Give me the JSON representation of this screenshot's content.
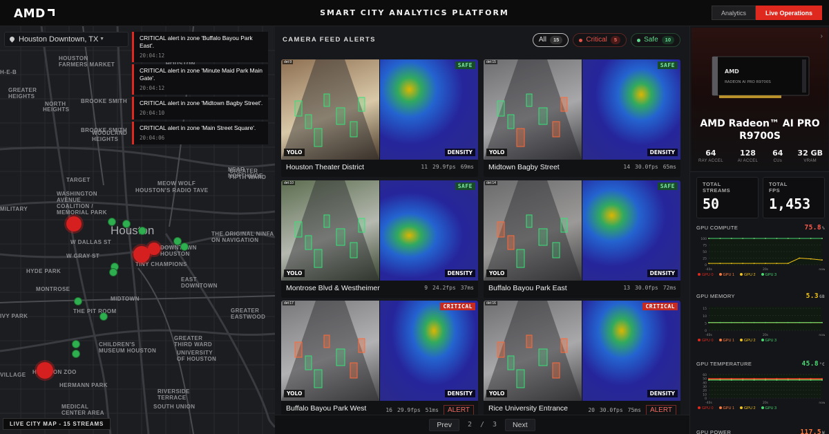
{
  "header": {
    "logo_text": "AMD",
    "title": "SMART CITY ANALYTICS PLATFORM",
    "tabs": [
      {
        "label": "Analytics",
        "active": false
      },
      {
        "label": "Live Operations",
        "active": true
      }
    ],
    "accent_color": "#e0291e"
  },
  "map": {
    "location": "Houston Downtown, TX",
    "footer_label": "LIVE CITY MAP - 15 STREAMS",
    "labels": [
      "MEYERLAND",
      "ZONE",
      "Houston\nFarmers Market",
      "H-E-B",
      "GREATER\nHEIGHTS",
      "NORTH",
      "HEIGHTS",
      "BROOKE SMITH",
      "BROOKE SMITH",
      "WOODLAND\nHEIGHTS",
      "Houston",
      "Target",
      "Meow Wolf",
      "Houston's Radio Tave",
      "NEAR\nNORTHSIDE",
      "GREATER\nFIFTH WARD",
      "WASHINGTON\nAVENUE\nCOALITION /\nMEMORIAL PARK",
      "MILITARY",
      "The Original Ninfa\non Navigation",
      "Houston",
      "DOWNTOWN\nHOUSTON",
      "Tiny Champions",
      "W Dallas St",
      "W Gray St",
      "HYDE PARK",
      "MONTROSE",
      "MIDTOWN",
      "EAST\nDOWNTOWN",
      "The Pit Room",
      "GREATER\nEASTWOOD",
      "Children's\nMuseum Houston",
      "GREATER\nTHIRD WARD",
      "University\nof Houston",
      "Houston Zoo",
      "Hermann Park",
      "MEDICAL\nCENTER AREA",
      "RIVERSIDE\nTERRACE",
      "SOUTH UNION",
      "VILLAGE",
      "Ivy Park"
    ],
    "markers": [
      {
        "status": "critical"
      },
      {
        "status": "critical"
      },
      {
        "status": "critical"
      },
      {
        "status": "critical"
      },
      {
        "status": "safe"
      },
      {
        "status": "safe"
      },
      {
        "status": "safe"
      },
      {
        "status": "safe"
      },
      {
        "status": "safe"
      },
      {
        "status": "safe"
      },
      {
        "status": "safe"
      },
      {
        "status": "safe"
      },
      {
        "status": "safe"
      },
      {
        "status": "safe"
      },
      {
        "status": "safe"
      }
    ]
  },
  "alerts": [
    {
      "text": "CRITICAL alert in zone 'Buffalo Bayou Park East'.",
      "time": "20:04:12"
    },
    {
      "text": "CRITICAL alert in zone 'Minute Maid Park Main Gate'.",
      "time": "20:04:12"
    },
    {
      "text": "CRITICAL alert in zone 'Midtown Bagby Street'.",
      "time": "20:04:10"
    },
    {
      "text": "CRITICAL alert in zone 'Main Street Square'.",
      "time": "20:04:06"
    }
  ],
  "feeds": {
    "title": "CAMERA FEED ALERTS",
    "filters": [
      {
        "label": "All",
        "count": "15"
      },
      {
        "label": "Critical",
        "count": "5"
      },
      {
        "label": "Safe",
        "count": "10"
      }
    ],
    "yolo_label": "YOLO",
    "density_label": "DENSITY",
    "alert_label": "ALERT",
    "cameras": [
      {
        "id": "det:9",
        "name": "Houston Theater District",
        "count": "11",
        "fps": "29.9fps",
        "latency": "69ms",
        "status": "SAFE"
      },
      {
        "id": "det:15",
        "name": "Midtown Bagby Street",
        "count": "14",
        "fps": "30.0fps",
        "latency": "65ms",
        "status": "SAFE"
      },
      {
        "id": "det:10",
        "name": "Montrose Blvd & Westheimer",
        "count": "9",
        "fps": "24.2fps",
        "latency": "37ms",
        "status": "SAFE"
      },
      {
        "id": "det:14",
        "name": "Buffalo Bayou Park East",
        "count": "13",
        "fps": "30.0fps",
        "latency": "72ms",
        "status": "SAFE"
      },
      {
        "id": "det:17",
        "name": "Buffalo Bayou Park West",
        "count": "16",
        "fps": "29.9fps",
        "latency": "51ms",
        "status": "CRITICAL"
      },
      {
        "id": "det:16",
        "name": "Rice University Entrance",
        "count": "20",
        "fps": "30.0fps",
        "latency": "75ms",
        "status": "CRITICAL"
      }
    ],
    "pager": {
      "prev": "Prev",
      "page": "2",
      "sep": "/",
      "total": "3",
      "next": "Next"
    }
  },
  "side": {
    "gpu_name": "AMD Radeon™ AI PRO\nR9700S",
    "card_label": "RADEON AI PRO R9700S",
    "specs": [
      {
        "value": "64",
        "label": "RAY ACCEL"
      },
      {
        "value": "128",
        "label": "AI ACCEL"
      },
      {
        "value": "64",
        "label": "CUs"
      },
      {
        "value": "32 GB",
        "label": "VRAM"
      }
    ],
    "kpis": [
      {
        "label": "TOTAL\nSTREAMS",
        "value": "50"
      },
      {
        "label": "TOTAL\nFPS",
        "value": "1,453"
      }
    ],
    "metrics": [
      {
        "key": "gpu_compute",
        "label": "GPU COMPUTE",
        "value": "75.8",
        "unit": "%",
        "color": "#ff5a4a",
        "y_ticks": [
          "100",
          "75",
          "50",
          "25",
          "0"
        ],
        "x_ticks": [
          "-40s",
          "20s",
          "now"
        ]
      },
      {
        "key": "gpu_memory",
        "label": "GPU MEMORY",
        "value": "5.3",
        "unit": "GB",
        "color": "#f5c518",
        "y_ticks": [
          "15",
          "10",
          "5",
          "0"
        ],
        "x_ticks": [
          "-40s",
          "20s",
          "now"
        ]
      },
      {
        "key": "gpu_temp",
        "label": "GPU TEMPERATURE",
        "value": "45.8",
        "unit": "°C",
        "color": "#49d872",
        "y_ticks": [
          "60",
          "50",
          "40",
          "30",
          "20",
          "10",
          "0"
        ],
        "x_ticks": [
          "-40s",
          "20s",
          "now"
        ]
      },
      {
        "key": "gpu_power",
        "label": "GPU POWER",
        "value": "117.5",
        "unit": "W",
        "color": "#ff7a3d"
      }
    ],
    "series_legend": [
      "GPU 0",
      "GPU 1",
      "GPU 2",
      "GPU 3"
    ],
    "series_colors": [
      "#e0291e",
      "#ff7a3d",
      "#f5c518",
      "#49d872"
    ]
  },
  "chart_data": [
    {
      "type": "line",
      "title": "GPU COMPUTE",
      "x": [
        -40,
        -36,
        -32,
        -28,
        -24,
        -20,
        -16,
        -12,
        -8,
        -4,
        0
      ],
      "x_ticks": [
        "-40s",
        "20s",
        "now"
      ],
      "ylim": [
        0,
        100
      ],
      "series": [
        {
          "name": "GPU 0",
          "values": [
            100,
            100,
            100,
            100,
            100,
            100,
            100,
            100,
            100,
            100,
            100
          ]
        },
        {
          "name": "GPU 1",
          "values": [
            100,
            100,
            100,
            100,
            100,
            100,
            100,
            100,
            100,
            100,
            100
          ]
        },
        {
          "name": "GPU 2",
          "values": [
            5,
            5,
            5,
            5,
            5,
            5,
            5,
            5,
            25,
            22,
            18
          ]
        },
        {
          "name": "GPU 3",
          "values": [
            100,
            100,
            100,
            100,
            100,
            100,
            100,
            100,
            100,
            100,
            100
          ]
        }
      ]
    },
    {
      "type": "line",
      "title": "GPU MEMORY",
      "x": [
        -40,
        -36,
        -32,
        -28,
        -24,
        -20,
        -16,
        -12,
        -8,
        -4,
        0
      ],
      "x_ticks": [
        "-40s",
        "20s",
        "now"
      ],
      "ylim": [
        0,
        16
      ],
      "series": [
        {
          "name": "GPU 0",
          "values": [
            5.3,
            5.3,
            5.3,
            5.3,
            5.3,
            5.3,
            5.3,
            5.3,
            5.3,
            5.3,
            5.3
          ]
        },
        {
          "name": "GPU 1",
          "values": [
            5.3,
            5.3,
            5.3,
            5.3,
            5.3,
            5.3,
            5.3,
            5.3,
            5.3,
            5.3,
            5.3
          ]
        },
        {
          "name": "GPU 2",
          "values": [
            5.3,
            5.3,
            5.3,
            5.3,
            5.3,
            5.3,
            5.3,
            5.3,
            5.3,
            5.3,
            5.3
          ]
        },
        {
          "name": "GPU 3",
          "values": [
            5.3,
            5.3,
            5.3,
            5.3,
            5.3,
            5.3,
            5.3,
            5.3,
            5.3,
            5.3,
            5.3
          ]
        }
      ]
    },
    {
      "type": "line",
      "title": "GPU TEMPERATURE",
      "x": [
        -40,
        -36,
        -32,
        -28,
        -24,
        -20,
        -16,
        -12,
        -8,
        -4,
        0
      ],
      "x_ticks": [
        "-40s",
        "20s",
        "now"
      ],
      "ylim": [
        0,
        60
      ],
      "series": [
        {
          "name": "GPU 0",
          "values": [
            50,
            50,
            50,
            50,
            50,
            50,
            50,
            50,
            50,
            50,
            50
          ]
        },
        {
          "name": "GPU 1",
          "values": [
            48,
            48,
            48,
            48,
            48,
            48,
            48,
            48,
            48,
            48,
            48
          ]
        },
        {
          "name": "GPU 2",
          "values": [
            46,
            46,
            46,
            46,
            46,
            46,
            46,
            46,
            46,
            46,
            46
          ]
        },
        {
          "name": "GPU 3",
          "values": [
            45.8,
            45.8,
            45.8,
            45.8,
            45.8,
            45.8,
            45.8,
            45.8,
            45.8,
            45.8,
            45.8
          ]
        }
      ]
    }
  ]
}
